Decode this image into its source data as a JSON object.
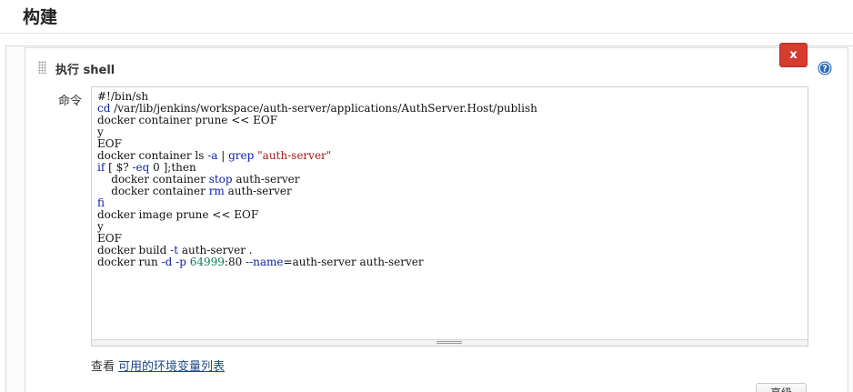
{
  "section": {
    "title": "构建"
  },
  "step": {
    "title": "执行 shell",
    "delete_label": "x",
    "help_icon": "help-icon",
    "command_label": "命令",
    "command_lines": [
      [
        {
          "t": "#!/bin/sh"
        }
      ],
      [
        {
          "t": "cd",
          "k": "kw"
        },
        {
          "t": " /var/lib/jenkins/workspace/auth-server/applications/AuthServer.Host/publish"
        }
      ],
      [
        {
          "t": "docker container prune << EOF"
        }
      ],
      [
        {
          "t": "y"
        }
      ],
      [
        {
          "t": "EOF"
        }
      ],
      [
        {
          "t": "docker container ls "
        },
        {
          "t": "-a",
          "k": "kw"
        },
        {
          "t": " | "
        },
        {
          "t": "grep",
          "k": "kw"
        },
        {
          "t": " "
        },
        {
          "t": "\"auth-server\"",
          "k": "str"
        }
      ],
      [
        {
          "t": "if",
          "k": "kw"
        },
        {
          "t": " [ $? "
        },
        {
          "t": "-eq",
          "k": "kw"
        },
        {
          "t": " 0 ];then"
        }
      ],
      [
        {
          "t": "    docker container "
        },
        {
          "t": "stop",
          "k": "kw"
        },
        {
          "t": " auth-server"
        }
      ],
      [
        {
          "t": "    docker container "
        },
        {
          "t": "rm",
          "k": "kw"
        },
        {
          "t": " auth-server"
        }
      ],
      [
        {
          "t": "fi",
          "k": "kw"
        }
      ],
      [
        {
          "t": "docker image prune << EOF"
        }
      ],
      [
        {
          "t": "y"
        }
      ],
      [
        {
          "t": "EOF"
        }
      ],
      [
        {
          "t": "docker build "
        },
        {
          "t": "-t",
          "k": "kw"
        },
        {
          "t": " auth-server ."
        }
      ],
      [
        {
          "t": "docker run "
        },
        {
          "t": "-d",
          "k": "kw"
        },
        {
          "t": " "
        },
        {
          "t": "-p",
          "k": "kw"
        },
        {
          "t": " "
        },
        {
          "t": "64999",
          "k": "num"
        },
        {
          "t": ":80 "
        },
        {
          "t": "--name",
          "k": "kw"
        },
        {
          "t": "=auth-server auth-server"
        }
      ]
    ],
    "env_hint_prefix": "查看",
    "env_link_label": "可用的环境变量列表",
    "advanced_label": "高级"
  },
  "colors": {
    "delete_button": "#d63b30",
    "link": "#204a87",
    "keyword": "#0b23a5",
    "string": "#a31a15",
    "number": "#0b7a5a"
  }
}
